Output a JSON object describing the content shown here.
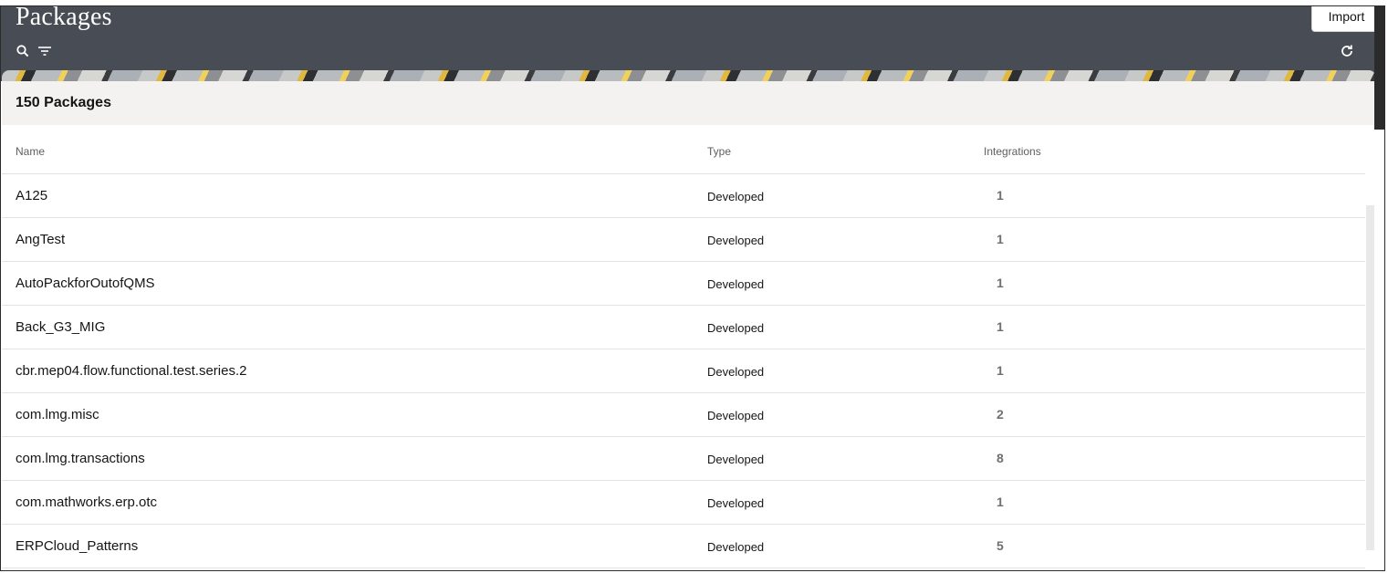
{
  "header": {
    "title": "Packages",
    "import_label": "Import",
    "icons": [
      "search-icon",
      "filter-icon",
      "refresh-icon"
    ]
  },
  "summary": {
    "count_label": "150 Packages"
  },
  "table": {
    "columns": [
      "Name",
      "Type",
      "Integrations"
    ],
    "rows": [
      {
        "name": "A125",
        "type": "Developed",
        "integrations": "1"
      },
      {
        "name": "AngTest",
        "type": "Developed",
        "integrations": "1"
      },
      {
        "name": "AutoPackforOutofQMS",
        "type": "Developed",
        "integrations": "1"
      },
      {
        "name": "Back_G3_MIG",
        "type": "Developed",
        "integrations": "1"
      },
      {
        "name": "cbr.mep04.flow.functional.test.series.2",
        "type": "Developed",
        "integrations": "1"
      },
      {
        "name": "com.lmg.misc",
        "type": "Developed",
        "integrations": "2"
      },
      {
        "name": "com.lmg.transactions",
        "type": "Developed",
        "integrations": "8"
      },
      {
        "name": "com.mathworks.erp.otc",
        "type": "Developed",
        "integrations": "1"
      },
      {
        "name": "ERPCloud_Patterns",
        "type": "Developed",
        "integrations": "5"
      }
    ]
  },
  "colors": {
    "header_bg": "#484c55",
    "count_bar_bg": "#f3f2f0",
    "text": "#161513"
  }
}
